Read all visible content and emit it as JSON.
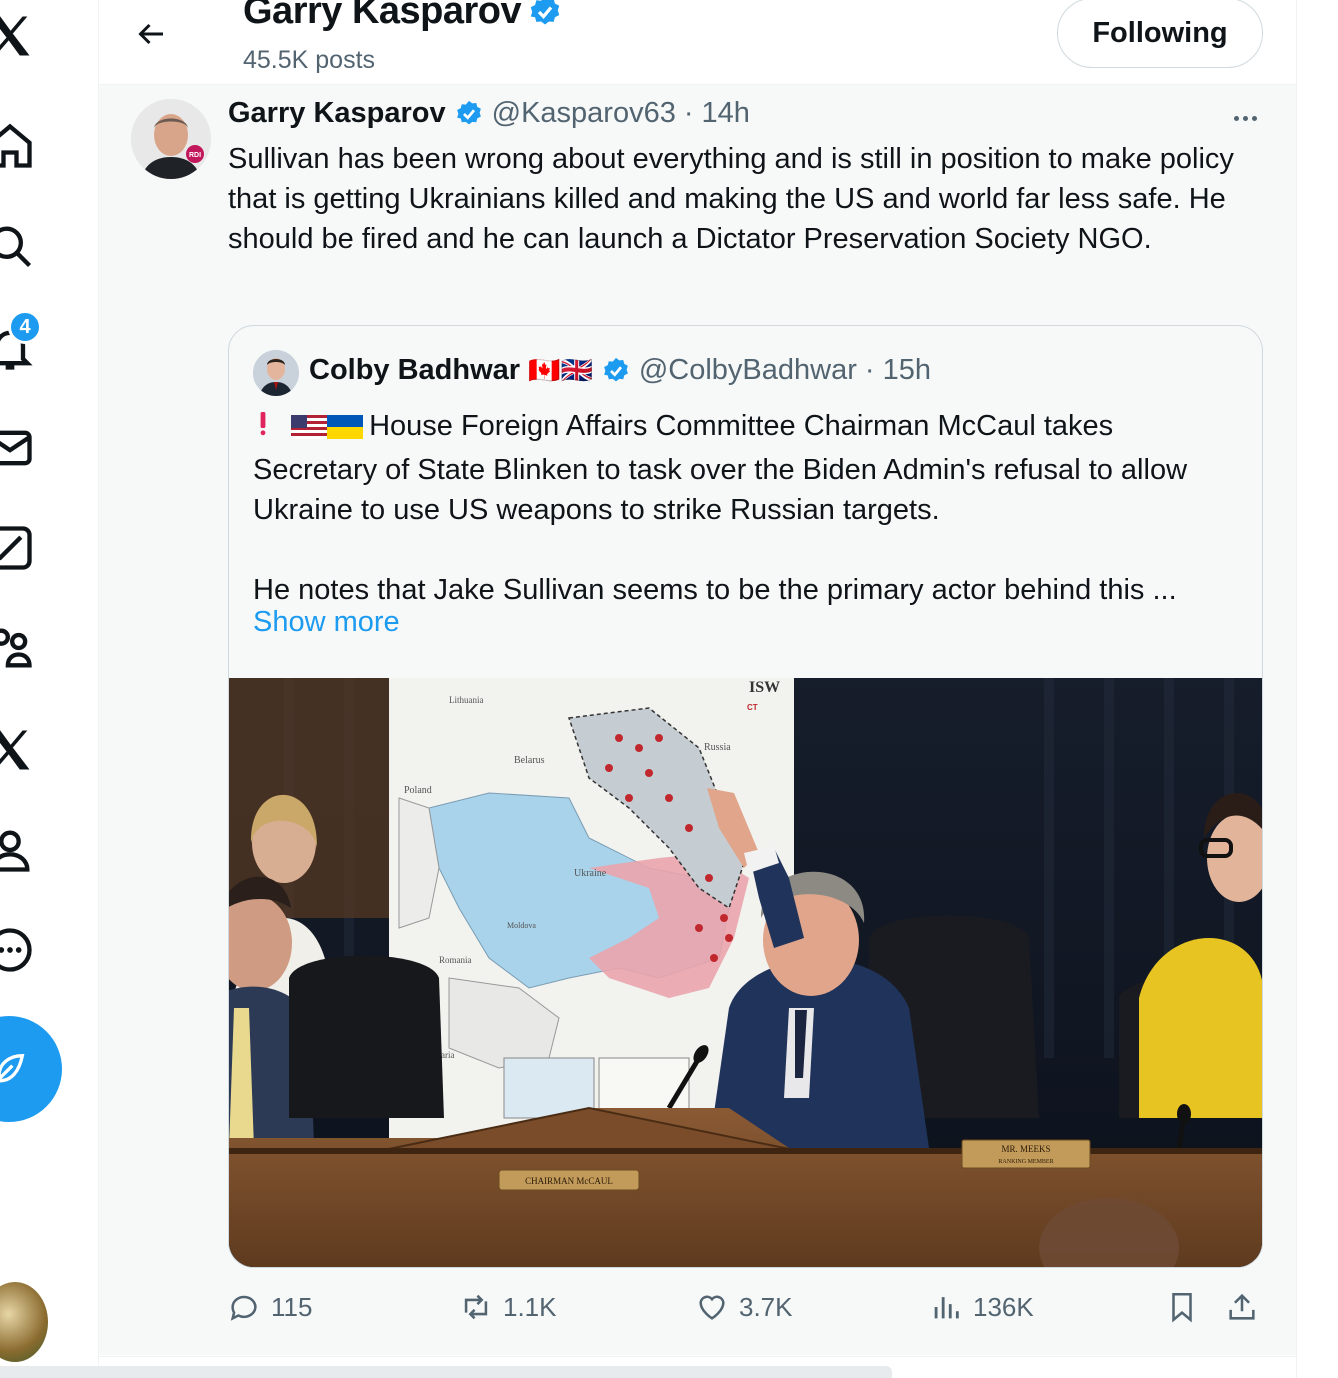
{
  "nav": {
    "notifications_badge": "4",
    "items": [
      "x-logo-icon",
      "home-icon",
      "search-icon",
      "notifications-icon",
      "messages-icon",
      "grok-icon",
      "communities-icon",
      "premium-icon",
      "profile-icon",
      "more-icon"
    ]
  },
  "header": {
    "name": "Garry Kasparov",
    "posts": "45.5K posts",
    "follow_label": "Following"
  },
  "tweet": {
    "author": "Garry Kasparov",
    "handle": "@Kasparov63",
    "sep": "·",
    "time": "14h",
    "text": "Sullivan has been wrong about everything and is still in position to make policy that is getting Ukrainians killed and making the US and world far less safe. He should be fired and he can launch a Dictator Preservation Society NGO."
  },
  "quote": {
    "author": "Colby Badhwar",
    "flags": "🇨🇦🇬🇧",
    "handle": "@ColbyBadhwar",
    "sep": "·",
    "time": "15h",
    "para1": "House Foreign Affairs Committee Chairman McCaul takes Secretary of State Blinken to task over the Biden Admin's refusal to allow Ukraine to use US weapons to strike Russian targets.",
    "para2": "He notes that Jake Sullivan seems to be the primary actor behind this ...",
    "show_more": "Show more",
    "media_labels": {
      "lithuania": "Lithuania",
      "belarus": "Belarus",
      "russia": "Russia",
      "poland": "Poland",
      "ukraine": "Ukraine",
      "moldova": "Moldova",
      "romania": "Romania",
      "bulgaria": "lgaria",
      "isw": "ISW",
      "ct": "CT",
      "chairman": "CHAIRMAN McCAUL",
      "meeks": "MR. MEEKS",
      "ranking": "RANKING MEMBER"
    }
  },
  "actions": {
    "replies": "115",
    "reposts": "1.1K",
    "likes": "3.7K",
    "views": "136K"
  },
  "colors": {
    "accent": "#1d9bf0",
    "muted": "#536471"
  }
}
